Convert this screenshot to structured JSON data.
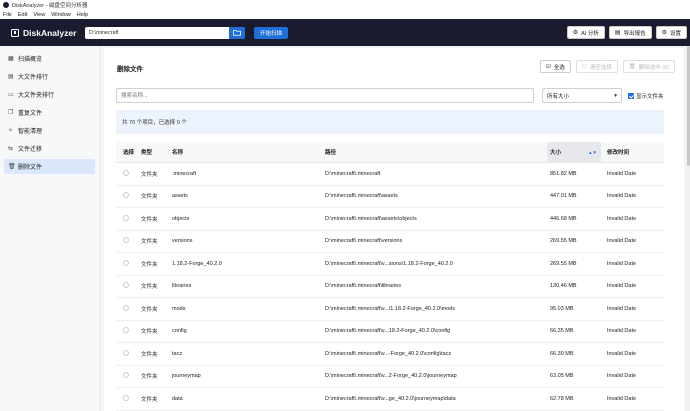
{
  "window": {
    "title": "DiskAnalyzer - 磁盘空间分析器"
  },
  "menu": [
    "File",
    "Edit",
    "View",
    "Window",
    "Help"
  ],
  "header": {
    "brand": "DiskAnalyzer",
    "path_value": "D:\\minecraft",
    "scan_label": "开始扫描",
    "ai_label": "AI 分析",
    "export_label": "导出报告",
    "settings_label": "设置"
  },
  "sidebar": {
    "items": [
      {
        "label": "扫描概览",
        "icon": "grid-icon"
      },
      {
        "label": "大文件排行",
        "icon": "file-list-icon"
      },
      {
        "label": "大文件夹排行",
        "icon": "folder-list-icon"
      },
      {
        "label": "重复文件",
        "icon": "copy-icon"
      },
      {
        "label": "智能清理",
        "icon": "sparkle-icon"
      },
      {
        "label": "文件迁移",
        "icon": "transfer-icon"
      },
      {
        "label": "删除文件",
        "icon": "trash-icon",
        "active": true
      }
    ]
  },
  "main": {
    "title": "删除文件",
    "select_all": "全选",
    "clear_selection": "清空选择",
    "delete_selected": "删除选中 (0)",
    "search_placeholder": "搜索名称...",
    "size_filter": "所有大小",
    "show_folders": "显示文件夹",
    "info": "共 70 个项目，已选择 0 个"
  },
  "table": {
    "headers": {
      "select": "选择",
      "type": "类型",
      "name": "名称",
      "path": "路径",
      "size": "大小",
      "modified": "修改时间"
    },
    "rows": [
      {
        "type": "文件夹",
        "name": ".minecraft",
        "path": "D:\\minecraft\\.minecraft",
        "size": "851.82 MB",
        "modified": "Invalid Date"
      },
      {
        "type": "文件夹",
        "name": "assets",
        "path": "D:\\minecraft\\.minecraft\\assets",
        "size": "447.01 MB",
        "modified": "Invalid Date"
      },
      {
        "type": "文件夹",
        "name": "objects",
        "path": "D:\\minecraft\\.minecraft\\assets\\objects",
        "size": "446.68 MB",
        "modified": "Invalid Date"
      },
      {
        "type": "文件夹",
        "name": "versions",
        "path": "D:\\minecraft\\.minecraft\\versions",
        "size": "269.55 MB",
        "modified": "Invalid Date"
      },
      {
        "type": "文件夹",
        "name": "1.18.2-Forge_40.2.0",
        "path": "D:\\minecraft\\.minecraft\\v...sions\\1.18.2-Forge_40.2.0",
        "size": "269.55 MB",
        "modified": "Invalid Date"
      },
      {
        "type": "文件夹",
        "name": "libraries",
        "path": "D:\\minecraft\\.minecraft\\libraries",
        "size": "130.46 MB",
        "modified": "Invalid Date"
      },
      {
        "type": "文件夹",
        "name": "mods",
        "path": "D:\\minecraft\\.minecraft\\v...\\1.18.2-Forge_40.2.0\\mods",
        "size": "95.03 MB",
        "modified": "Invalid Date"
      },
      {
        "type": "文件夹",
        "name": "config",
        "path": "D:\\minecraft\\.minecraft\\v...18.2-Forge_40.2.0\\config",
        "size": "66.35 MB",
        "modified": "Invalid Date"
      },
      {
        "type": "文件夹",
        "name": "tacz",
        "path": "D:\\minecraft\\.minecraft\\v...-Forge_40.2.0\\config\\tacz",
        "size": "66.30 MB",
        "modified": "Invalid Date"
      },
      {
        "type": "文件夹",
        "name": "journeymap",
        "path": "D:\\minecraft\\.minecraft\\v...2-Forge_40.2.0\\journeymap",
        "size": "63.05 MB",
        "modified": "Invalid Date"
      },
      {
        "type": "文件夹",
        "name": "data",
        "path": "D:\\minecraft\\.minecraft\\v...ge_40.2.0\\journeymap\\data",
        "size": "62.78 MB",
        "modified": "Invalid Date"
      }
    ]
  }
}
